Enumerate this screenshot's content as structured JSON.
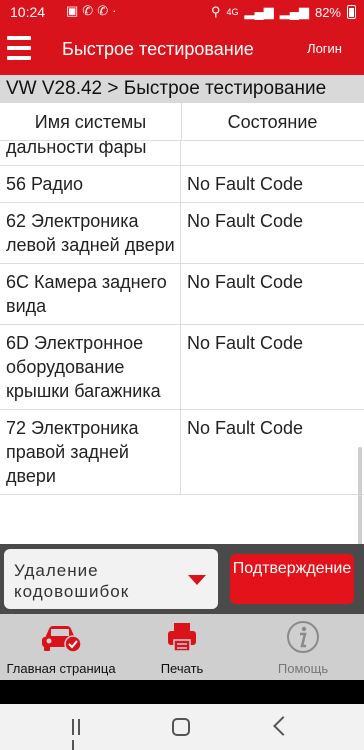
{
  "status_bar": {
    "time": "10:24",
    "network_label": "4G",
    "battery": "82%",
    "battery_level": 0.82
  },
  "app_bar": {
    "title": "Быстрое тестирование",
    "login": "Логин"
  },
  "breadcrumb": "VW V28.42 > Быстрое тестирование",
  "table": {
    "headers": [
      "Имя системы",
      "Состояние"
    ],
    "rows": [
      {
        "name": "дальности фары",
        "state": ""
      },
      {
        "name": "56 Радио",
        "state": "No Fault Code"
      },
      {
        "name": "62 Электроника левой задней двери",
        "state": "No Fault Code"
      },
      {
        "name": "6C Камера заднего вида",
        "state": "No Fault Code"
      },
      {
        "name": "6D Электронное оборудование крышки багажника",
        "state": "No Fault Code"
      },
      {
        "name": "72 Электроника правой задней двери",
        "state": "No Fault Code"
      }
    ]
  },
  "action_bar": {
    "dropdown_value": "Удаление кодовошибок",
    "confirm_label": "Подтверждение"
  },
  "toolbar": {
    "home": "Главная страница",
    "print": "Печать",
    "help": "Помощь"
  },
  "colors": {
    "brand_red": "#d8131b",
    "action_bar_bg": "#4a4a4a",
    "toolbar_bg": "#cfcfcf"
  },
  "icons": [
    "menu-icon",
    "car-check-icon",
    "printer-icon",
    "info-icon",
    "location-icon",
    "wifi-icon",
    "signal-icon",
    "battery-icon"
  ]
}
